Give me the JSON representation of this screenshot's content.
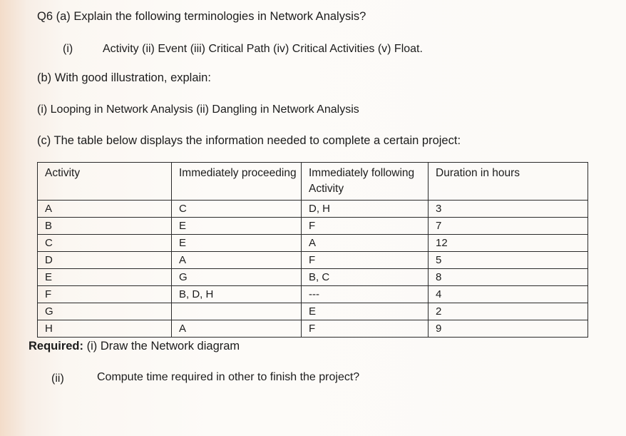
{
  "question": {
    "heading": "Q6 (a) Explain the following terminologies in Network Analysis?",
    "a_item_number": "(i)",
    "a_item_text": "Activity (ii) Event (iii) Critical Path (iv) Critical Activities (v) Float.",
    "b_heading": "(b) With good illustration, explain:",
    "b_item": "(i) Looping in Network Analysis (ii) Dangling in Network Analysis",
    "c_heading": "(c) The table below displays the information needed to complete a certain project:"
  },
  "table": {
    "headers": [
      "Activity",
      "Immediately proceeding",
      "Immediately following Activity",
      "Duration in hours"
    ],
    "rows": [
      {
        "activity": "A",
        "proceeding": "C",
        "following": "D, H",
        "duration": "3"
      },
      {
        "activity": "B",
        "proceeding": "E",
        "following": "F",
        "duration": "7"
      },
      {
        "activity": "C",
        "proceeding": "E",
        "following": "A",
        "duration": "12"
      },
      {
        "activity": "D",
        "proceeding": "A",
        "following": "F",
        "duration": "5"
      },
      {
        "activity": "E",
        "proceeding": "G",
        "following": "B, C",
        "duration": "8"
      },
      {
        "activity": "F",
        "proceeding": "B, D, H",
        "following": "---",
        "duration": "4"
      },
      {
        "activity": "G",
        "proceeding": "",
        "following": "E",
        "duration": "2"
      },
      {
        "activity": "H",
        "proceeding": "A",
        "following": "F",
        "duration": "9"
      }
    ]
  },
  "required": {
    "label": "Required:",
    "item_i": " (i) Draw the Network diagram",
    "item_ii_number": "(ii)",
    "item_ii_text": "Compute time required in other to finish the project?"
  }
}
